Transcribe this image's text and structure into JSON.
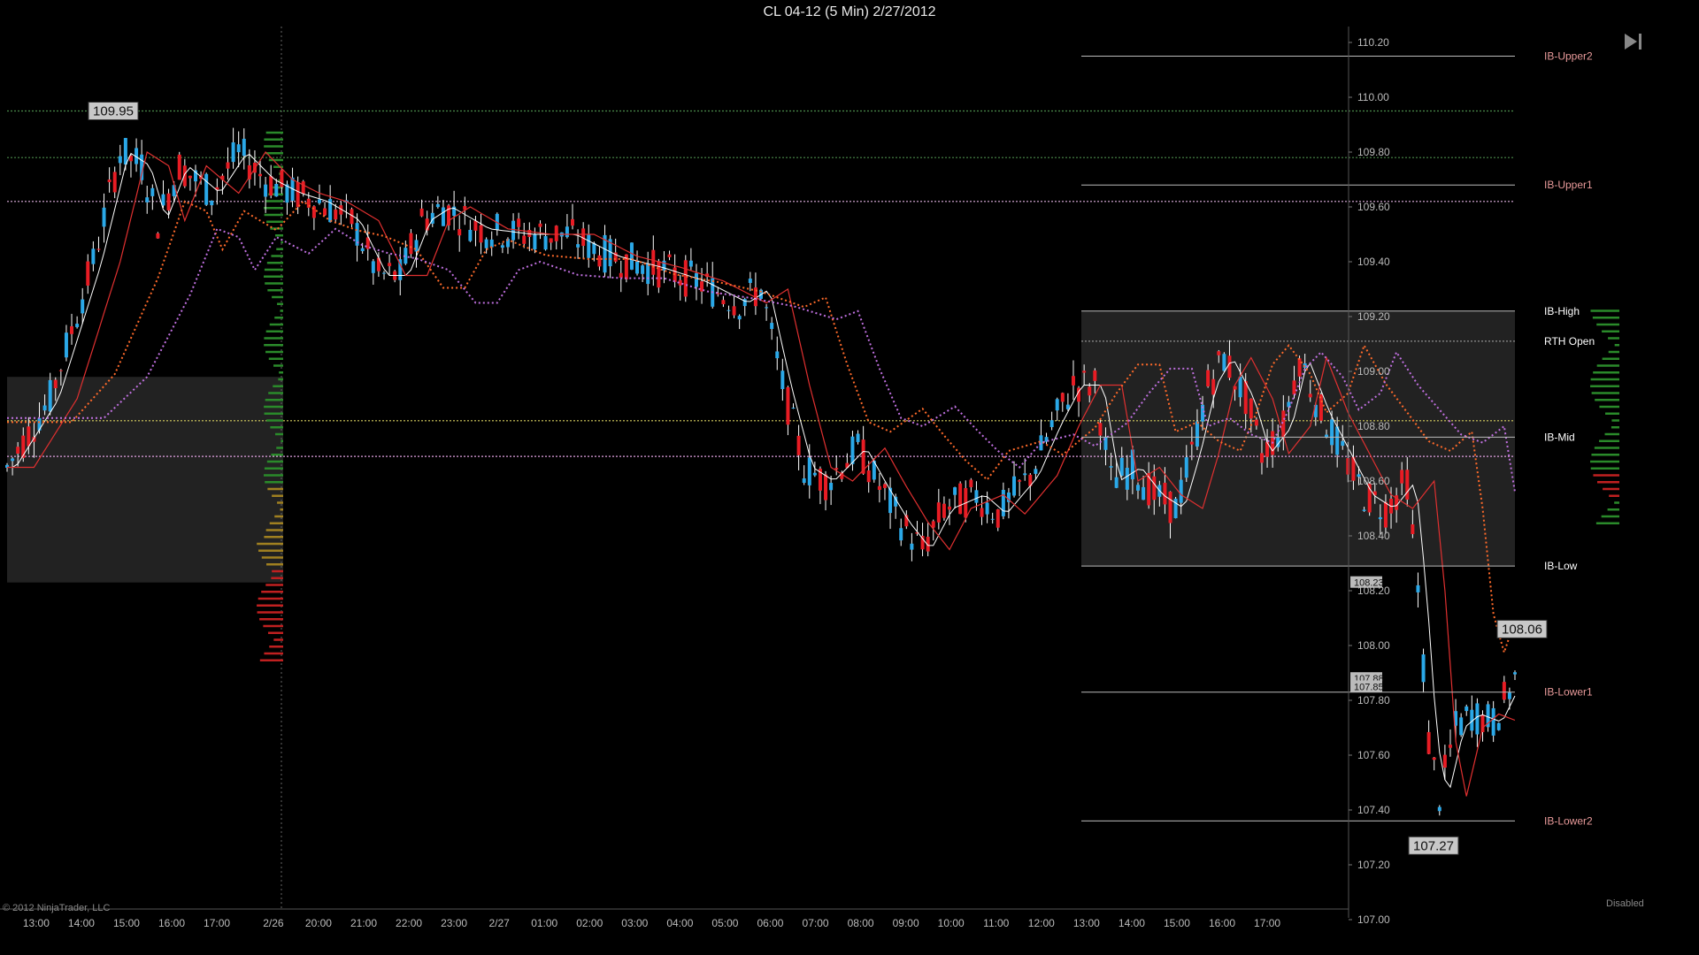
{
  "window": {
    "title": "CL 04-12 (5 Min)  2/27/2012",
    "copyright": "© 2012 NinjaTrader, LLC",
    "status": "Disabled",
    "nav_icon": "jump-to-end-icon"
  },
  "colors": {
    "background": "#000000",
    "up_candle": "#2aa8e8",
    "down_candle": "#e81c24",
    "wick": "#ffffff",
    "ema_fast": "#ffffff",
    "ema_slow": "#e03030",
    "vwap_orange": "#ff6a2a",
    "vwap_violet": "#c070e0",
    "ib_label": "#e89a9a",
    "ib_box": "#2a2a2a"
  },
  "chart_data": {
    "type": "candlestick",
    "ylim": [
      107.0,
      110.25
    ],
    "y_ticks": [
      "110.20",
      "110.00",
      "109.80",
      "109.60",
      "109.40",
      "109.20",
      "109.00",
      "108.80",
      "108.60",
      "108.40",
      "108.20",
      "108.00",
      "107.80",
      "107.60",
      "107.40",
      "107.20",
      "107.00"
    ],
    "x_ticks": [
      "13:00",
      "14:00",
      "15:00",
      "16:00",
      "17:00",
      "2/26",
      "20:00",
      "21:00",
      "22:00",
      "23:00",
      "2/27",
      "01:00",
      "02:00",
      "03:00",
      "04:00",
      "05:00",
      "06:00",
      "07:00",
      "08:00",
      "09:00",
      "10:00",
      "11:00",
      "12:00",
      "13:00",
      "14:00",
      "15:00",
      "16:00",
      "17:00"
    ],
    "price_path": [
      [
        0,
        108.65
      ],
      [
        40,
        108.9
      ],
      [
        80,
        109.4
      ],
      [
        105,
        109.8
      ],
      [
        125,
        109.75
      ],
      [
        140,
        109.55
      ],
      [
        160,
        109.75
      ],
      [
        190,
        109.65
      ],
      [
        215,
        109.8
      ],
      [
        240,
        109.7
      ],
      [
        265,
        109.65
      ],
      [
        290,
        109.62
      ],
      [
        320,
        109.55
      ],
      [
        345,
        109.35
      ],
      [
        365,
        109.35
      ],
      [
        385,
        109.55
      ],
      [
        405,
        109.6
      ],
      [
        440,
        109.52
      ],
      [
        480,
        109.5
      ],
      [
        520,
        109.5
      ],
      [
        560,
        109.42
      ],
      [
        600,
        109.38
      ],
      [
        640,
        109.33
      ],
      [
        680,
        109.25
      ],
      [
        700,
        109.3
      ],
      [
        720,
        108.95
      ],
      [
        740,
        108.65
      ],
      [
        760,
        108.6
      ],
      [
        790,
        108.72
      ],
      [
        810,
        108.58
      ],
      [
        830,
        108.45
      ],
      [
        850,
        108.35
      ],
      [
        870,
        108.5
      ],
      [
        900,
        108.55
      ],
      [
        920,
        108.48
      ],
      [
        950,
        108.62
      ],
      [
        970,
        108.8
      ],
      [
        990,
        108.95
      ],
      [
        1010,
        108.95
      ],
      [
        1025,
        108.6
      ],
      [
        1045,
        108.65
      ],
      [
        1065,
        108.55
      ],
      [
        1085,
        108.5
      ],
      [
        1100,
        108.7
      ],
      [
        1115,
        108.95
      ],
      [
        1130,
        109.05
      ],
      [
        1150,
        108.9
      ],
      [
        1165,
        108.7
      ],
      [
        1185,
        108.8
      ],
      [
        1200,
        109.05
      ],
      [
        1220,
        108.85
      ],
      [
        1240,
        108.7
      ],
      [
        1260,
        108.55
      ],
      [
        1280,
        108.5
      ],
      [
        1300,
        108.6
      ],
      [
        1310,
        108.2
      ],
      [
        1320,
        107.65
      ],
      [
        1330,
        107.45
      ],
      [
        1345,
        107.7
      ],
      [
        1360,
        107.75
      ],
      [
        1380,
        107.72
      ],
      [
        1400,
        107.88
      ]
    ],
    "series": [
      {
        "name": "",
        "kind": "ema-fast"
      },
      {
        "name": "",
        "kind": "ema-slow"
      },
      {
        "name": "",
        "kind": "vwap-orange"
      },
      {
        "name": "",
        "kind": "vwap-violet"
      }
    ],
    "ib_levels": [
      {
        "label": "IB-Upper2",
        "value": 110.15
      },
      {
        "label": "IB-Upper1",
        "value": 109.68
      },
      {
        "label": "IB-High",
        "value": 109.22
      },
      {
        "label": "RTH Open",
        "value": 109.11
      },
      {
        "label": "IB-Mid",
        "value": 108.76
      },
      {
        "label": "IB-Low",
        "value": 108.29
      },
      {
        "label": "IB-Lower1",
        "value": 107.83
      },
      {
        "label": "IB-Lower2",
        "value": 107.36
      }
    ],
    "box_labels": [
      {
        "text": "109.95",
        "value": 109.95
      },
      {
        "text": "108.06",
        "value": 108.06
      },
      {
        "text": "107.27",
        "value": 107.27
      }
    ],
    "price_flags": [
      {
        "text": "108.23",
        "value": 108.23
      },
      {
        "text": "107.88",
        "value": 107.88
      },
      {
        "text": "107.85",
        "value": 107.85
      }
    ]
  }
}
